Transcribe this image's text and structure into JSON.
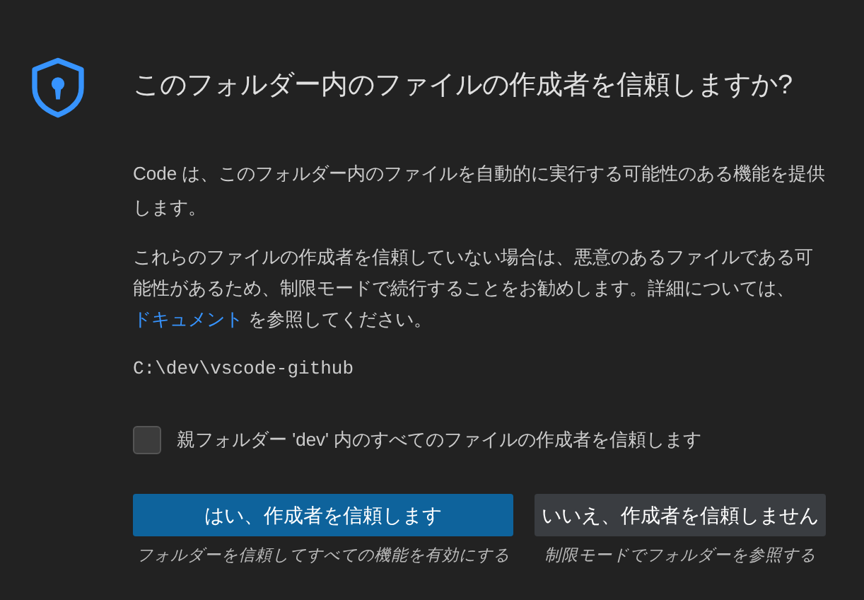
{
  "title": "このフォルダー内のファイルの作成者を信頼しますか?",
  "message": "Code は、このフォルダー内のファイルを自動的に実行する可能性のある機能を提供します。",
  "detail": [
    {
      "kind": "text",
      "text": "これらのファイルの作成者を信頼していない場合は、悪意のあるファイルである可能性があるため、制限モードで続行することをお勧めします。詳細については、"
    },
    {
      "kind": "link",
      "text": "ドキュメント"
    },
    {
      "kind": "text",
      "text": " を参照してください。"
    }
  ],
  "path": "C:\\dev\\vscode-github",
  "checkbox": {
    "label": "親フォルダー 'dev' 内のすべてのファイルの作成者を信頼します",
    "checked": false
  },
  "buttons": [
    {
      "label": "はい、作成者を信頼します",
      "caption": "フォルダーを信頼してすべての機能を有効にする",
      "kind": "primary"
    },
    {
      "label": "いいえ、作成者を信頼しません",
      "caption": "制限モードでフォルダーを参照する",
      "kind": "secondary"
    }
  ]
}
